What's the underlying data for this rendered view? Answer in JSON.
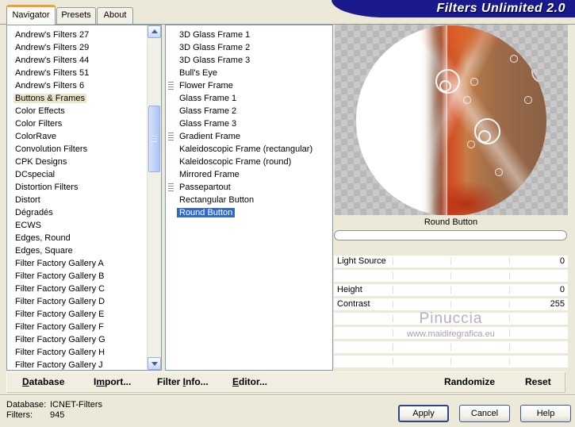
{
  "window": {
    "title": "Filters Unlimited 2.0"
  },
  "tabs": [
    {
      "label": "Navigator",
      "active": true
    },
    {
      "label": "Presets",
      "active": false
    },
    {
      "label": "About",
      "active": false
    }
  ],
  "category_list": {
    "selected_index": 5,
    "items": [
      {
        "label": "Andrew's Filters 27"
      },
      {
        "label": "Andrew's Filters 29"
      },
      {
        "label": "Andrew's Filters 44"
      },
      {
        "label": "Andrew's Filters 51"
      },
      {
        "label": "Andrew's Filters 6"
      },
      {
        "label": "Buttons & Frames"
      },
      {
        "label": "Color Effects"
      },
      {
        "label": "Color Filters"
      },
      {
        "label": "ColorRave"
      },
      {
        "label": "Convolution Filters"
      },
      {
        "label": "CPK Designs"
      },
      {
        "label": "DCspecial"
      },
      {
        "label": "Distortion Filters"
      },
      {
        "label": "Distort"
      },
      {
        "label": "Dégradés"
      },
      {
        "label": "ECWS"
      },
      {
        "label": "Edges, Round"
      },
      {
        "label": "Edges, Square"
      },
      {
        "label": "Filter Factory Gallery A"
      },
      {
        "label": "Filter Factory Gallery B"
      },
      {
        "label": "Filter Factory Gallery C"
      },
      {
        "label": "Filter Factory Gallery D"
      },
      {
        "label": "Filter Factory Gallery E"
      },
      {
        "label": "Filter Factory Gallery F"
      },
      {
        "label": "Filter Factory Gallery G"
      },
      {
        "label": "Filter Factory Gallery H"
      },
      {
        "label": "Filter Factory Gallery J"
      }
    ]
  },
  "filter_list": {
    "selected_index": 14,
    "items": [
      {
        "label": "3D Glass Frame 1",
        "icon": false
      },
      {
        "label": "3D Glass Frame 2",
        "icon": false
      },
      {
        "label": "3D Glass Frame 3",
        "icon": false
      },
      {
        "label": "Bull's Eye",
        "icon": false
      },
      {
        "label": "Flower Frame",
        "icon": true
      },
      {
        "label": "Glass Frame 1",
        "icon": false
      },
      {
        "label": "Glass Frame 2",
        "icon": false
      },
      {
        "label": "Glass Frame 3",
        "icon": false
      },
      {
        "label": "Gradient Frame",
        "icon": true
      },
      {
        "label": "Kaleidoscopic Frame (rectangular)",
        "icon": false
      },
      {
        "label": "Kaleidoscopic Frame (round)",
        "icon": false
      },
      {
        "label": "Mirrored Frame",
        "icon": false
      },
      {
        "label": "Passepartout",
        "icon": true
      },
      {
        "label": "Rectangular Button",
        "icon": false
      },
      {
        "label": "Round Button",
        "icon": false
      }
    ]
  },
  "preview": {
    "caption": "Round Button",
    "progress_percent": 0
  },
  "controls": {
    "rows": [
      {
        "label": "Light Source",
        "value": "0"
      },
      {
        "label": "",
        "value": ""
      },
      {
        "label": "Height",
        "value": "0"
      },
      {
        "label": "Contrast",
        "value": "255"
      },
      {
        "label": "",
        "value": ""
      },
      {
        "label": "",
        "value": ""
      },
      {
        "label": "",
        "value": ""
      },
      {
        "label": "",
        "value": ""
      }
    ]
  },
  "watermark": {
    "line1": "Pinuccia",
    "line2": "www.maidiregrafica.eu"
  },
  "command_bar": {
    "database": {
      "pre": "",
      "key": "D",
      "rest": "atabase"
    },
    "import": {
      "pre": "I",
      "key": "m",
      "rest": "port..."
    },
    "filter_info": {
      "pre": "Filter ",
      "key": "I",
      "rest": "nfo..."
    },
    "editor": {
      "pre": "",
      "key": "E",
      "rest": "ditor..."
    },
    "randomize": "Randomize",
    "reset": "Reset"
  },
  "status": {
    "database_label": "Database:",
    "database_value": "ICNET-Filters",
    "filters_label": "Filters:",
    "filters_value": "945"
  },
  "footer_buttons": {
    "apply": "Apply",
    "cancel": "Cancel",
    "help": "Help"
  },
  "colors": {
    "selection_blue": "#316ac5",
    "title_navy": "#1a1a8c",
    "tab_accent_orange": "#f0a12f",
    "background_beige": "#ece9d8"
  }
}
